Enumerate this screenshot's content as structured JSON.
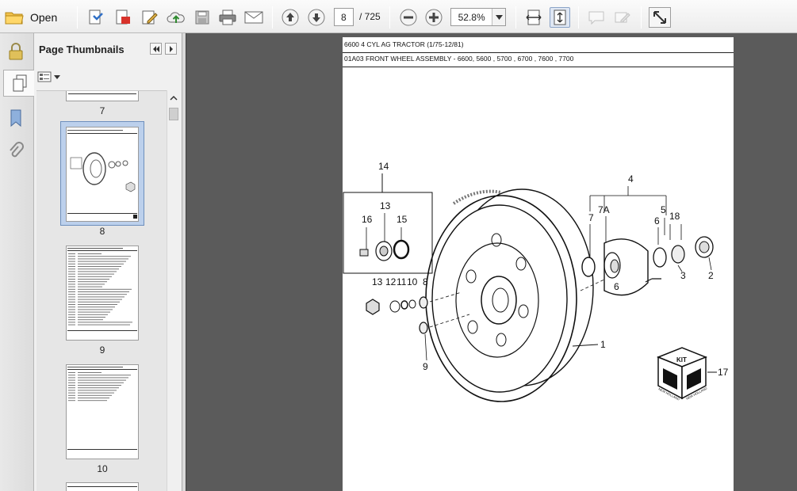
{
  "toolbar": {
    "open_label": "Open",
    "current_page": "8",
    "page_total": "/ 725",
    "zoom_value": "52.8%"
  },
  "panel": {
    "title": "Page Thumbnails",
    "thumbnails": [
      {
        "label": "7"
      },
      {
        "label": "8"
      },
      {
        "label": "9"
      },
      {
        "label": "10"
      }
    ]
  },
  "document": {
    "header_line1": "6600 4 CYL AG TRACTOR (1/75-12/81)",
    "header_line2": "01A03 FRONT WHEEL ASSEMBLY - 6600, 5600 , 5700 , 6700 , 7600 , 7700",
    "callouts": {
      "c14": "14",
      "c13a": "13",
      "c15": "15",
      "c16": "16",
      "c13b": "13",
      "c12": "12",
      "c11": "11",
      "c10": "10",
      "c8": "8",
      "c9": "9",
      "c1": "1",
      "c4": "4",
      "c7": "7",
      "c7a": "7A",
      "c5": "5",
      "c6": "6",
      "c18": "18",
      "c3": "3",
      "c2": "2",
      "c17": "17",
      "c6b": "6",
      "kit": "KIT",
      "brand1": "NEW HOLLAND",
      "brand2": "NEW HOLLAND"
    }
  }
}
